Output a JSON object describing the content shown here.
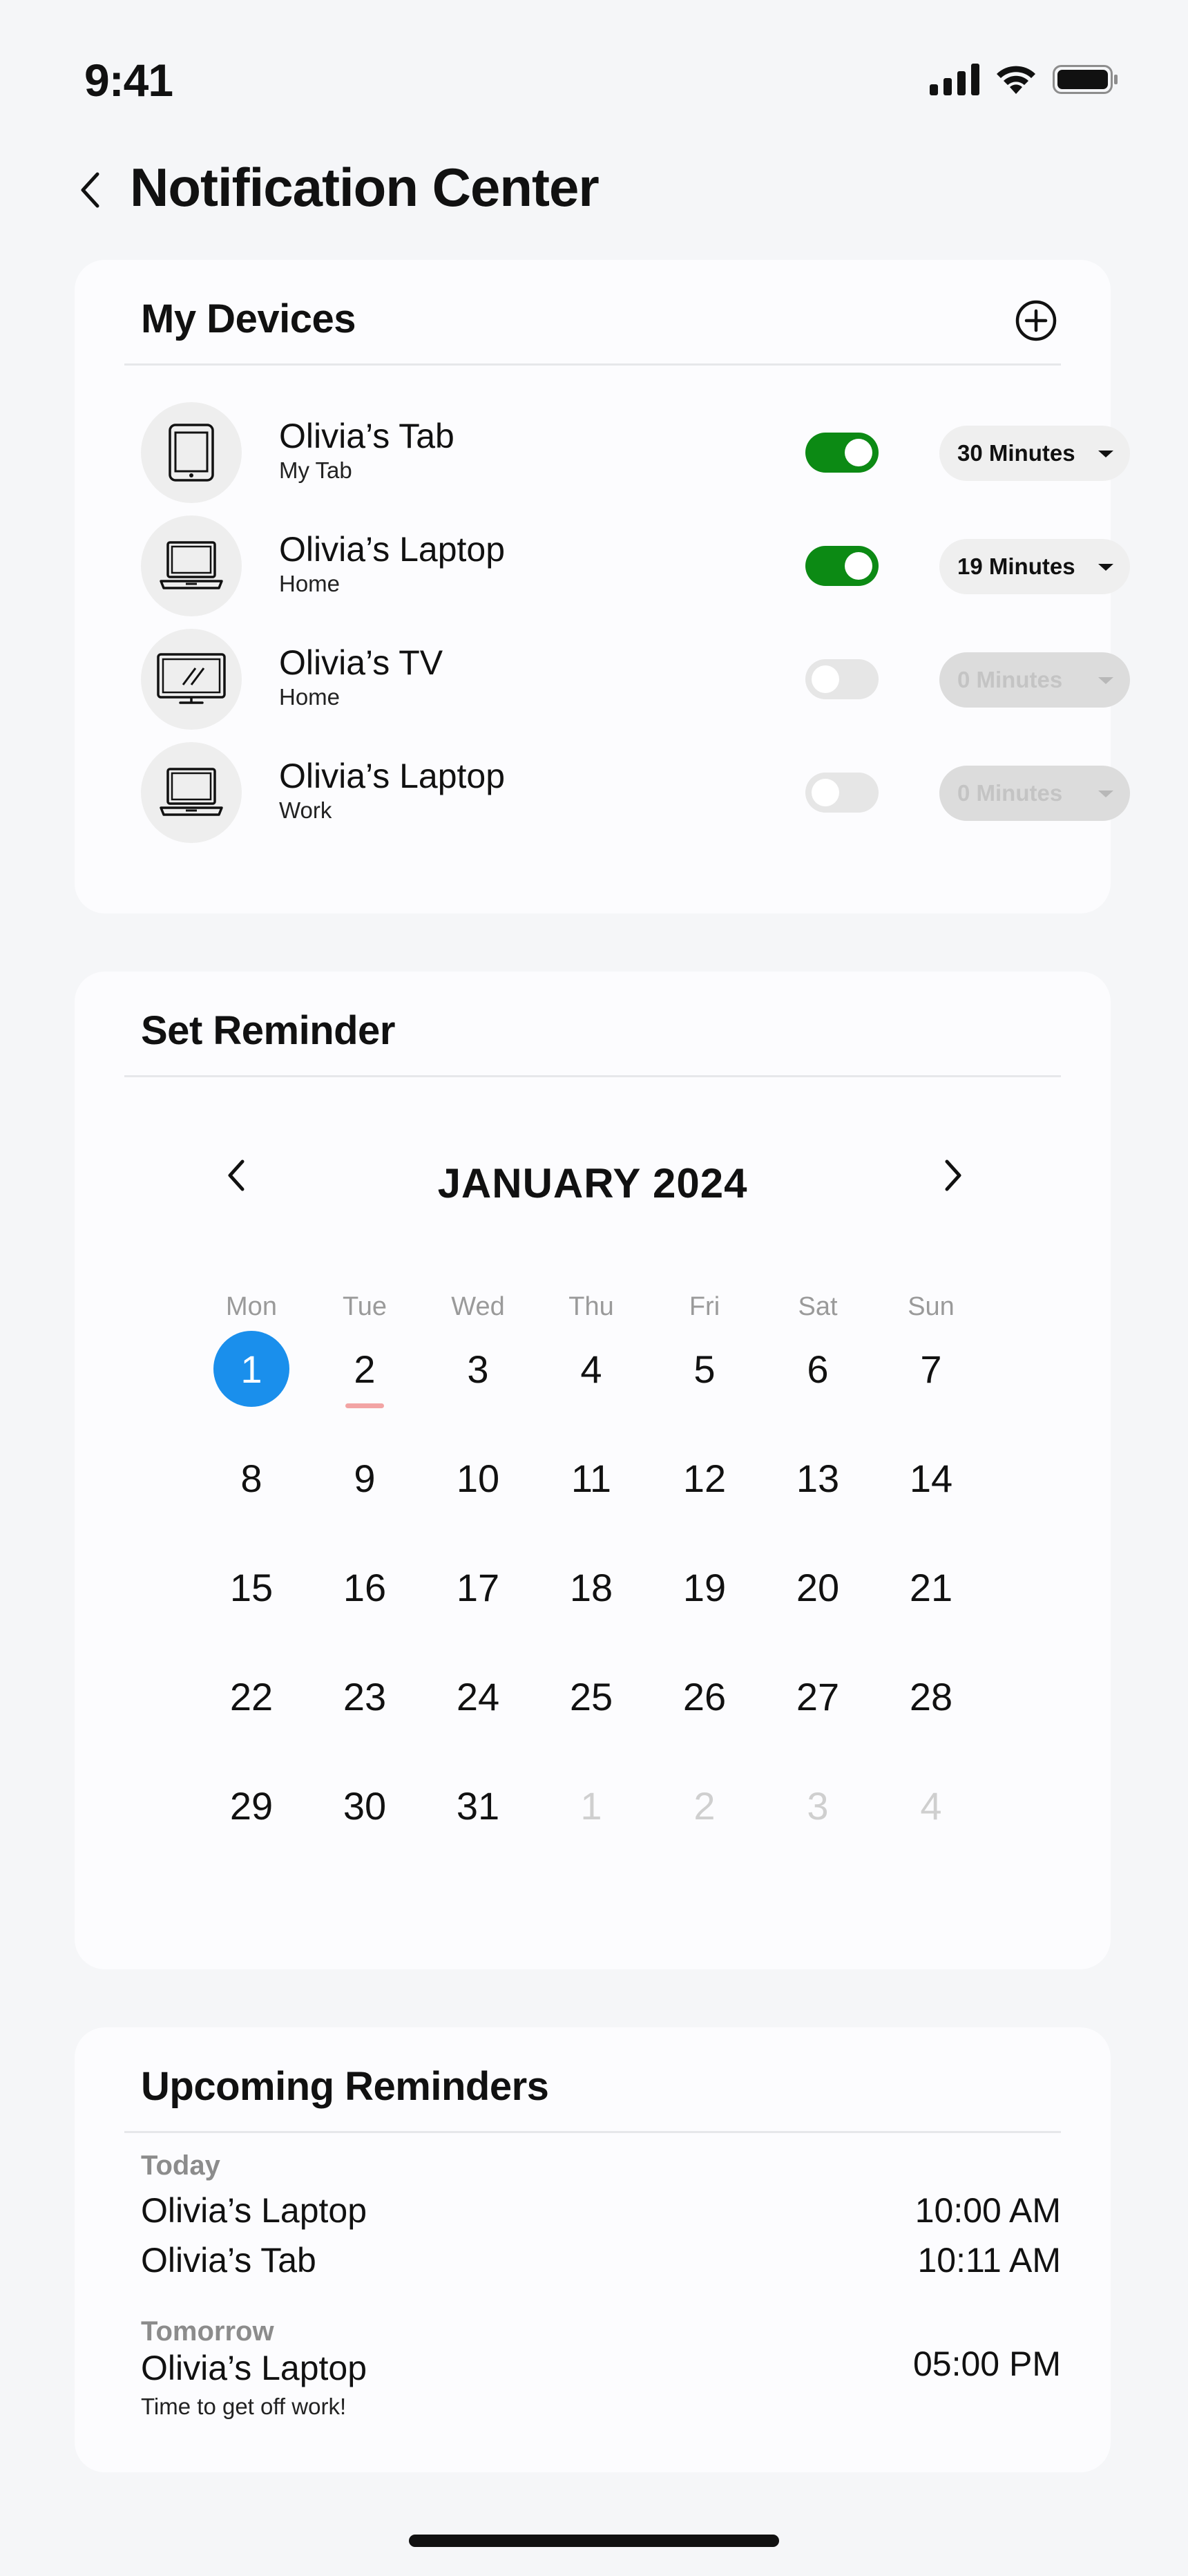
{
  "status": {
    "time": "9:41"
  },
  "header": {
    "title": "Notification Center"
  },
  "devices": {
    "title": "My Devices",
    "items": [
      {
        "name": "Olivia’s Tab",
        "location": "My Tab",
        "icon": "tablet-icon",
        "enabled": true,
        "duration": "30 Minutes"
      },
      {
        "name": "Olivia’s Laptop",
        "location": "Home",
        "icon": "laptop-icon",
        "enabled": true,
        "duration": "19 Minutes"
      },
      {
        "name": "Olivia’s TV",
        "location": "Home",
        "icon": "tv-icon",
        "enabled": false,
        "duration": "0 Minutes"
      },
      {
        "name": "Olivia’s Laptop",
        "location": "Work",
        "icon": "laptop-icon",
        "enabled": false,
        "duration": "0 Minutes"
      }
    ]
  },
  "reminder": {
    "title": "Set Reminder",
    "month": "JANUARY 2024",
    "weekdays": [
      "Mon",
      "Tue",
      "Wed",
      "Thu",
      "Fri",
      "Sat",
      "Sun"
    ],
    "weeks": [
      [
        "1",
        "2",
        "3",
        "4",
        "5",
        "6",
        "7"
      ],
      [
        "8",
        "9",
        "10",
        "11",
        "12",
        "13",
        "14"
      ],
      [
        "15",
        "16",
        "17",
        "18",
        "19",
        "20",
        "21"
      ],
      [
        "22",
        "23",
        "24",
        "25",
        "26",
        "27",
        "28"
      ],
      [
        "29",
        "30",
        "31",
        "1",
        "2",
        "3",
        "4"
      ]
    ],
    "selected_day": "1",
    "today_day": "2",
    "colors": {
      "selected": "#1a8fec",
      "today_marker": "#f2a4a4"
    }
  },
  "upcoming": {
    "title": "Upcoming Reminders",
    "groups": [
      {
        "label": "Today",
        "items": [
          {
            "name": "Olivia’s Laptop",
            "time": "10:00 AM"
          },
          {
            "name": "Olivia’s Tab",
            "time": "10:11 AM"
          }
        ]
      },
      {
        "label": "Tomorrow",
        "items": [
          {
            "name": "Olivia’s Laptop",
            "time": "05:00 PM",
            "note": "Time to get off work!"
          }
        ]
      }
    ]
  },
  "colors": {
    "toggle_on": "#0c8a14",
    "toggle_off": "#e6e6e6",
    "background": "#f5f6f8"
  }
}
